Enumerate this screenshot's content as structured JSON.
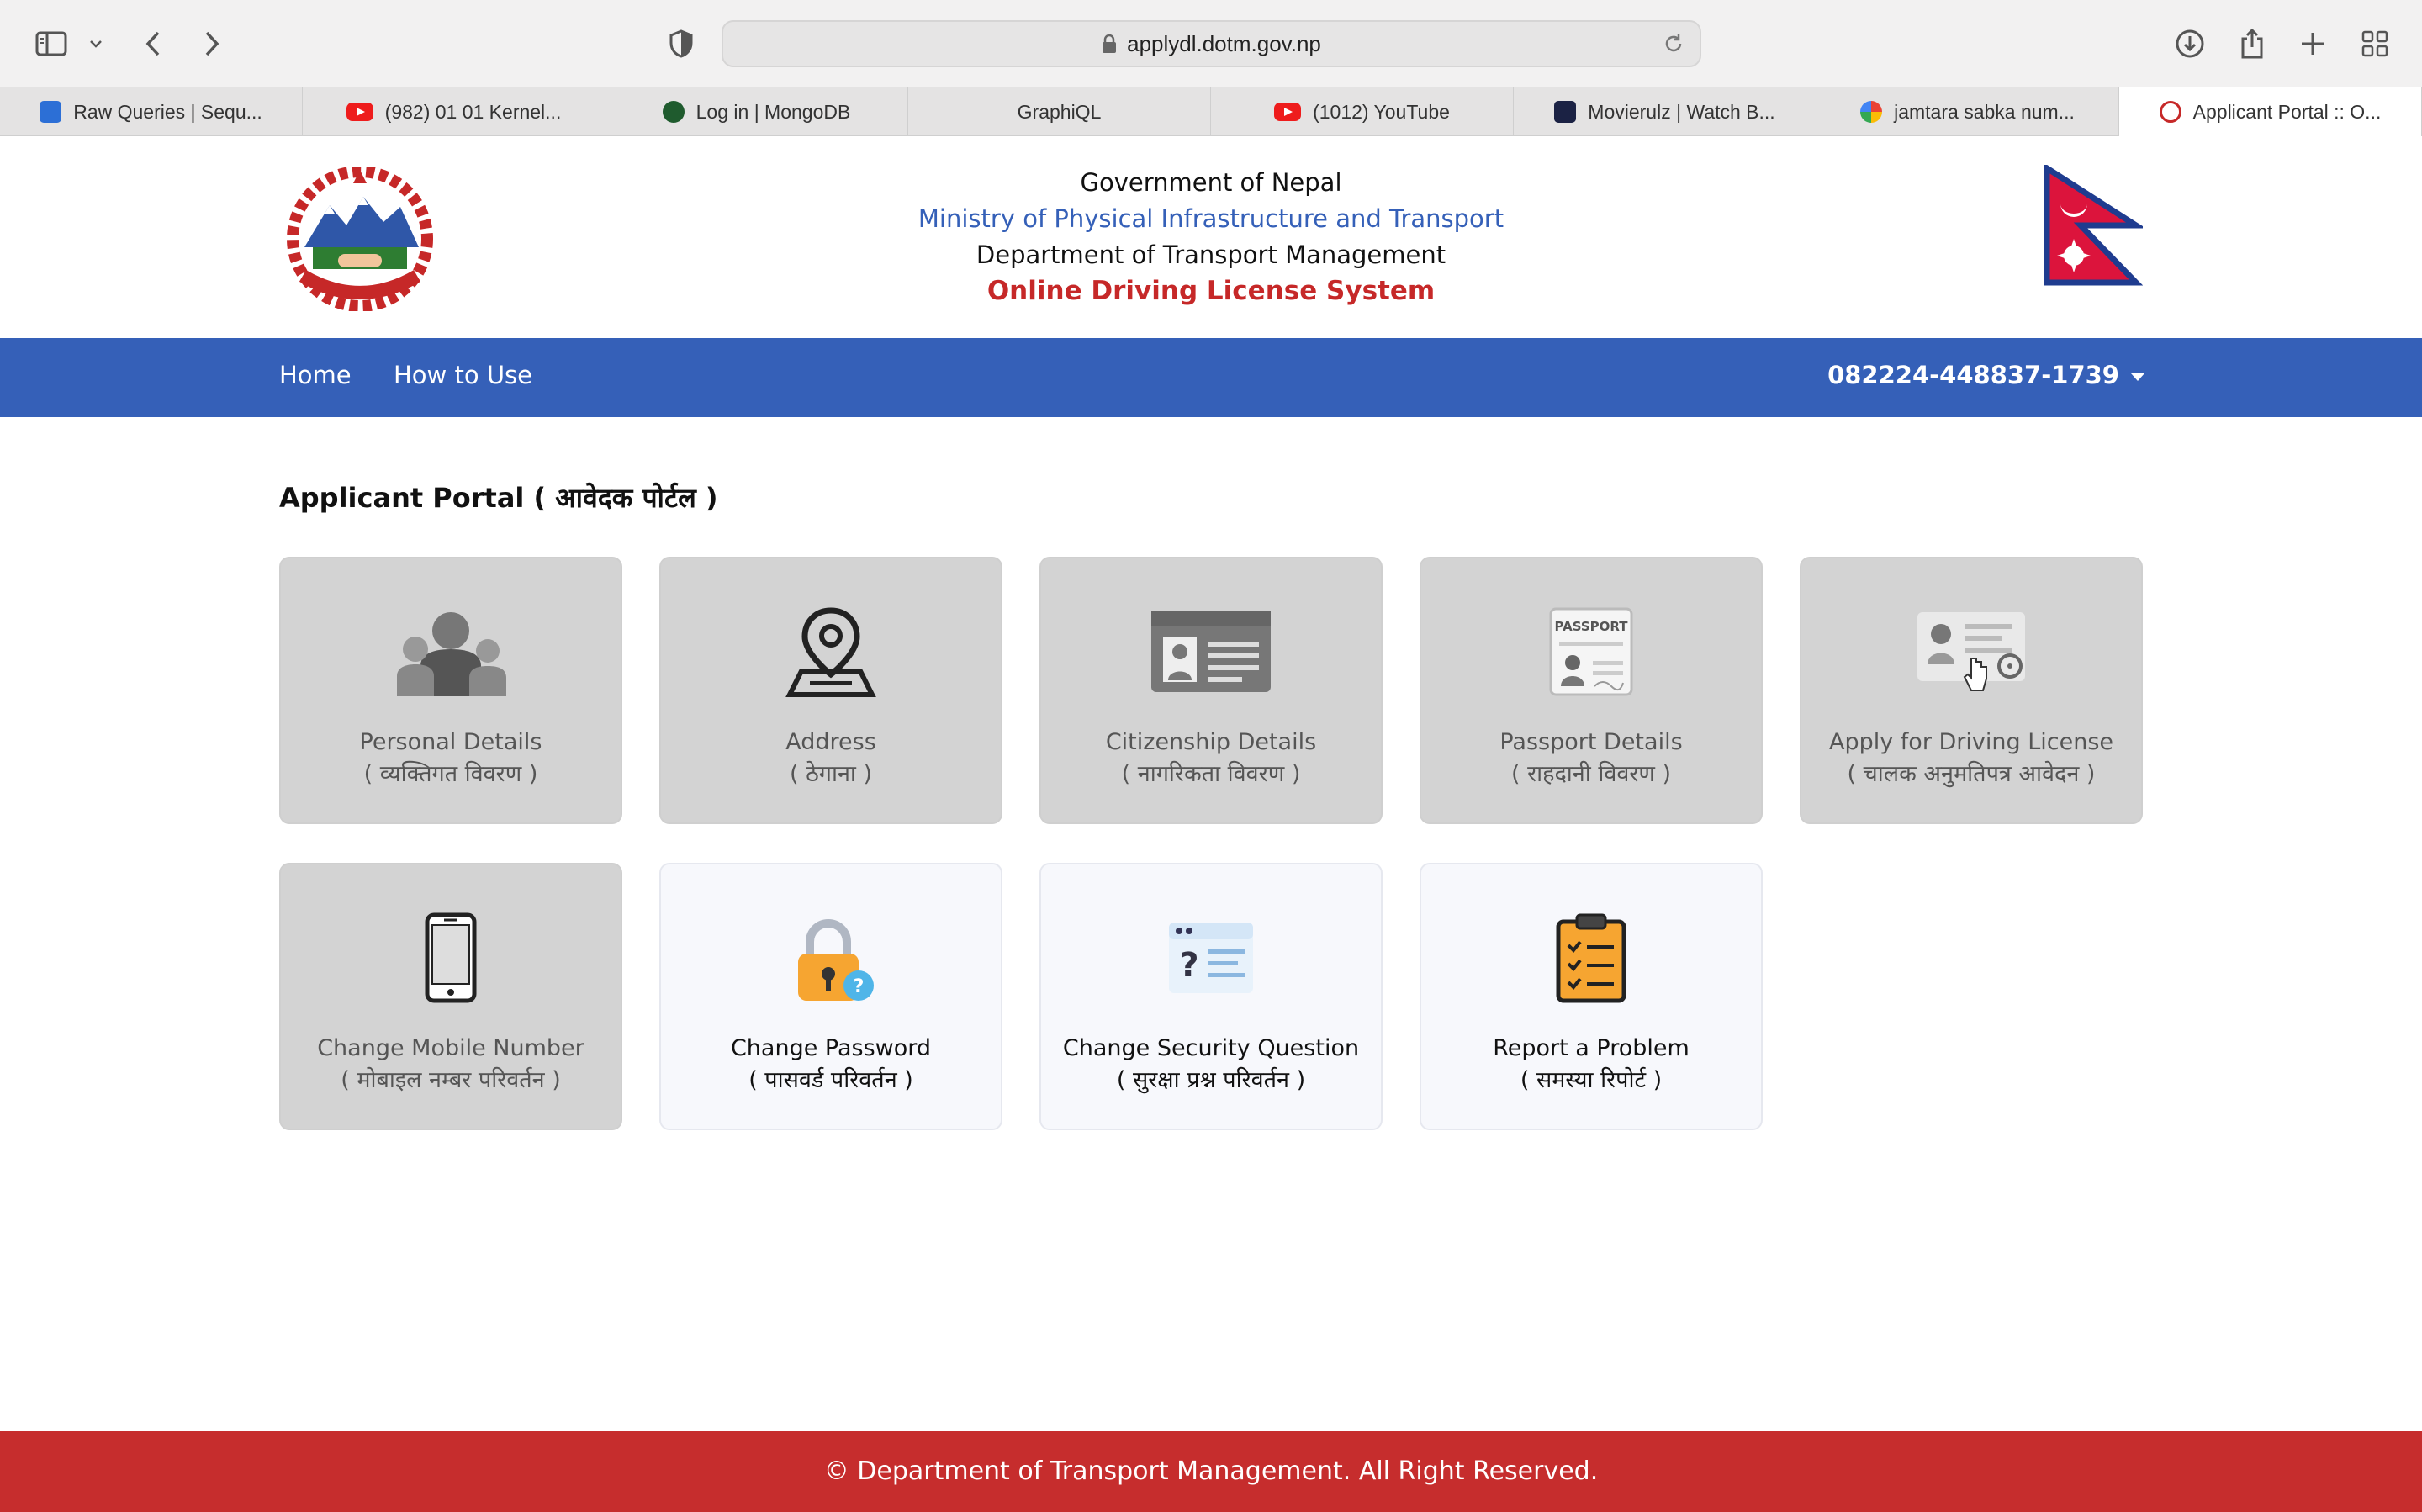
{
  "browser": {
    "url": "applydl.dotm.gov.np",
    "tabs": [
      {
        "label": "Raw Queries | Sequ...",
        "icon": "cube-icon"
      },
      {
        "label": "(982) 01 01 Kernel...",
        "icon": "youtube-icon"
      },
      {
        "label": "Log in | MongoDB",
        "icon": "mongodb-icon"
      },
      {
        "label": "GraphiQL",
        "icon": ""
      },
      {
        "label": "(1012) YouTube",
        "icon": "youtube-icon"
      },
      {
        "label": "Movierulz | Watch B...",
        "icon": "movie-icon"
      },
      {
        "label": "jamtara sabka num...",
        "icon": "google-icon"
      },
      {
        "label": "Applicant Portal :: O...",
        "icon": "emblem-icon"
      }
    ]
  },
  "header": {
    "line1": "Government of Nepal",
    "line2": "Ministry of Physical Infrastructure and Transport",
    "line3": "Department of Transport Management",
    "line4": "Online Driving License System"
  },
  "nav": {
    "home": "Home",
    "how_to_use": "How to Use",
    "user_id": "082224-448837-1739"
  },
  "portal": {
    "title": "Applicant Portal ( आवेदक पोर्टल )",
    "cards": [
      {
        "en": "Personal Details",
        "np": "( व्यक्तिगत विवरण )",
        "icon": "family-icon",
        "enabled": false
      },
      {
        "en": "Address",
        "np": "( ठेगाना )",
        "icon": "map-pin-icon",
        "enabled": false
      },
      {
        "en": "Citizenship Details",
        "np": "( नागरिकता विवरण )",
        "icon": "id-card-icon",
        "enabled": false
      },
      {
        "en": "Passport Details",
        "np": "( राहदानी विवरण )",
        "icon": "passport-icon",
        "enabled": false
      },
      {
        "en": "Apply for Driving License",
        "np": "( चालक अनुमतिपत्र आवेदन )",
        "icon": "driving-license-icon",
        "enabled": false
      },
      {
        "en": "Change Mobile Number",
        "np": "( मोबाइल नम्बर परिवर्तन )",
        "icon": "mobile-phone-icon",
        "enabled": false
      },
      {
        "en": "Change Password",
        "np": "( पासवर्ड परिवर्तन )",
        "icon": "padlock-icon",
        "enabled": true
      },
      {
        "en": "Change Security Question",
        "np": "( सुरक्षा प्रश्न परिवर्तन )",
        "icon": "security-question-icon",
        "enabled": true
      },
      {
        "en": "Report a Problem",
        "np": "( समस्या रिपोर्ट )",
        "icon": "clipboard-checklist-icon",
        "enabled": true
      }
    ]
  },
  "footer": {
    "text": "© Department of Transport Management. All Right Reserved."
  },
  "colors": {
    "nav_blue": "#3560b8",
    "brand_red": "#c62d2d"
  }
}
